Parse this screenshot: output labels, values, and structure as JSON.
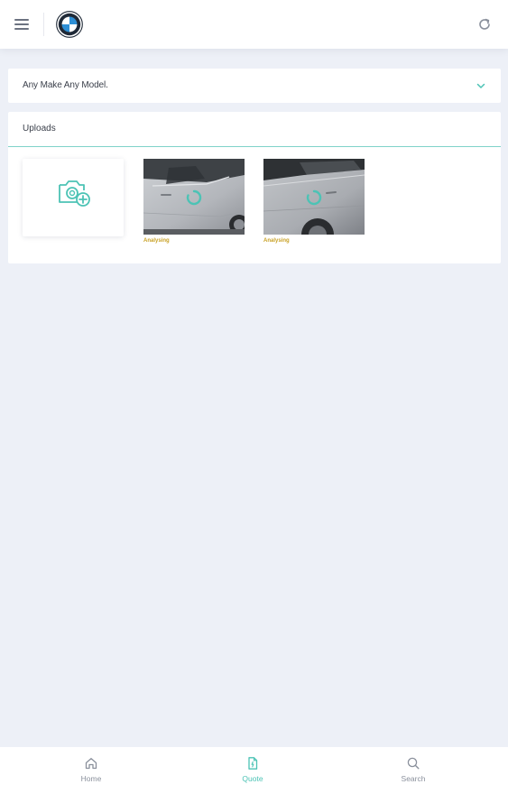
{
  "header": {
    "menu_icon": "hamburger-menu-icon",
    "brand_icon": "bmw-roundel-logo",
    "refresh_icon": "refresh-icon"
  },
  "vehicle_select": {
    "value": "Any Make Any Model.",
    "chevron_icon": "chevron-down-icon"
  },
  "uploads": {
    "title": "Uploads",
    "add_icon": "camera-add-icon",
    "items": [
      {
        "status": "Analysing",
        "image": "silver-car-door-photo"
      },
      {
        "status": "Analysing",
        "image": "silver-car-rear-door-photo"
      }
    ]
  },
  "bottom_nav": {
    "items": [
      {
        "label": "Home",
        "icon": "home-icon",
        "active": false
      },
      {
        "label": "Quote",
        "icon": "document-icon",
        "active": true
      },
      {
        "label": "Search",
        "icon": "search-icon",
        "active": false
      }
    ]
  },
  "colors": {
    "accent": "#4cc3b5",
    "status_warning": "#c9a227",
    "background": "#edf0f7",
    "card": "#ffffff"
  }
}
